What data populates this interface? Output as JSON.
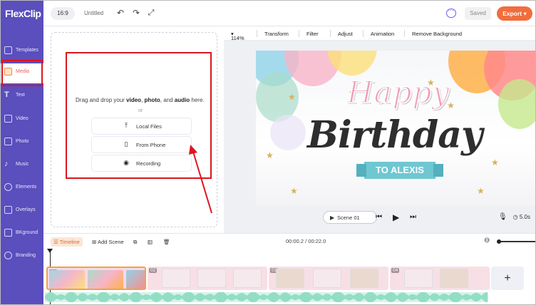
{
  "app": {
    "logo": "FlexClip",
    "brand_color": "#5b4ebd",
    "accent_color": "#f26d3d"
  },
  "topbar": {
    "ratio": "16:9",
    "title": "Untitled",
    "undo_icon": "undo-icon",
    "redo_icon": "redo-icon",
    "fullscreen_icon": "fullscreen-icon",
    "saved_label": "Saved",
    "export_label": "Export"
  },
  "sidebar": {
    "items": [
      {
        "label": "Templates",
        "icon": "layers-icon"
      },
      {
        "label": "Media",
        "icon": "folder-icon",
        "active": true
      },
      {
        "label": "Text",
        "icon": "text-icon"
      },
      {
        "label": "Video",
        "icon": "video-icon"
      },
      {
        "label": "Photo",
        "icon": "photo-icon"
      },
      {
        "label": "Music",
        "icon": "music-icon"
      },
      {
        "label": "Elements",
        "icon": "elements-icon"
      },
      {
        "label": "Overlays",
        "icon": "overlays-icon"
      },
      {
        "label": "BKground",
        "icon": "background-icon"
      },
      {
        "label": "Branding",
        "icon": "branding-icon"
      }
    ]
  },
  "media_panel": {
    "drop_prefix": "Drag and drop your",
    "drop_video": "video",
    "drop_comma": ",",
    "drop_photo": "photo",
    "drop_and": ", and",
    "drop_audio": "audio",
    "drop_suffix": "here.",
    "or": "or",
    "buttons": [
      {
        "label": "Local Files",
        "icon": "upload-icon"
      },
      {
        "label": "From Phone",
        "icon": "phone-icon"
      },
      {
        "label": "Recording",
        "icon": "record-icon"
      }
    ]
  },
  "edit_toolbar": {
    "zoom": "114%",
    "items": [
      "Transform",
      "Filter",
      "Adjust",
      "Animation",
      "Remove Background"
    ]
  },
  "canvas": {
    "line1": "Happy",
    "line2": "Birthday",
    "banner": "TO ALEXIS"
  },
  "playback": {
    "scene_label": "Scene 01",
    "duration": "5.0s"
  },
  "timeline": {
    "timeline_label": "Timeline",
    "add_scene_label": "Add Scene",
    "time_readout": "00:00.2 / 00:22.0",
    "clips": [
      {
        "num": "01"
      },
      {
        "num": "02"
      },
      {
        "num": "03"
      },
      {
        "num": "04"
      }
    ],
    "add_label": "+"
  }
}
